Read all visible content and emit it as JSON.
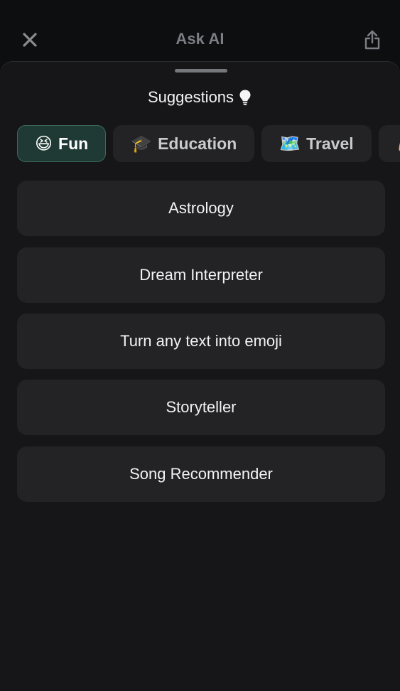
{
  "header": {
    "title": "Ask AI",
    "close_icon": "close-icon",
    "share_icon": "share-icon"
  },
  "sheet": {
    "title": "Suggestions",
    "title_icon": "lightbulb-icon"
  },
  "categories": [
    {
      "emoji": "😆",
      "label": "Fun",
      "active": true
    },
    {
      "emoji": "🎓",
      "label": "Education",
      "active": false
    },
    {
      "emoji": "🗺️",
      "label": "Travel",
      "active": false
    },
    {
      "emoji": "💪",
      "label": "",
      "active": false
    }
  ],
  "suggestions": [
    {
      "label": "Astrology"
    },
    {
      "label": "Dream Interpreter"
    },
    {
      "label": "Turn any text into emoji"
    },
    {
      "label": "Storyteller"
    },
    {
      "label": "Song Recommender"
    }
  ],
  "colors": {
    "background": "#0d0e10",
    "sheet": "#161618",
    "card": "#232326",
    "active_chip": "#1f3a34",
    "active_chip_border": "#3a6a5c",
    "muted_text": "#7c7e84"
  }
}
